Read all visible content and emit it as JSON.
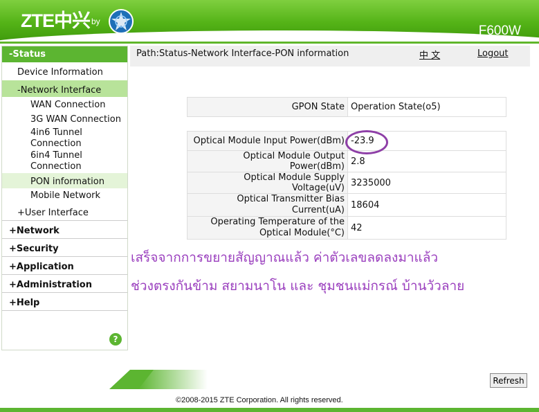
{
  "header": {
    "logo": "ZTE中兴",
    "by": "by",
    "model": "F600W"
  },
  "sidebar": {
    "status": "-Status",
    "device_information": "Device Information",
    "network_interface": "-Network Interface",
    "wan_connection": "WAN Connection",
    "wan_3g": "3G WAN Connection",
    "tunnel_4in6_line1": "4in6 Tunnel",
    "tunnel_4in6_line2": "Connection",
    "tunnel_6in4_line1": "6in4 Tunnel",
    "tunnel_6in4_line2": "Connection",
    "pon_information": "PON information",
    "mobile_network": "Mobile Network",
    "user_interface": "+User Interface",
    "network": "+Network",
    "security": "+Security",
    "application": "+Application",
    "administration": "+Administration",
    "help": "+Help",
    "help_icon": "?"
  },
  "main": {
    "path": "Path:Status-Network Interface-PON information",
    "lang": "中 文",
    "logout": "Logout",
    "gpon": {
      "label": "GPON State",
      "value": "Operation State(o5)"
    },
    "rows": [
      {
        "label": "Optical Module Input Power(dBm)",
        "value": "-23.9"
      },
      {
        "label": "Optical Module Output Power(dBm)",
        "value": "2.8"
      },
      {
        "label": "Optical Module Supply Voltage(uV)",
        "value": "3235000"
      },
      {
        "label_line1": "Optical Transmitter Bias",
        "label_line2": "Current(uA)",
        "value": "18604"
      },
      {
        "label_line1": "Operating Temperature of the",
        "label_line2": "Optical Module(°C)",
        "value": "42"
      }
    ],
    "thai_line1": "เสร็จจากการขยายสัญญาณแล้ว ค่าตัวเลขลดลงมาแล้ว",
    "thai_line2": "ช่วงตรงกันข้าม สยามนาโน และ ชุมชนแม่กรณ์ บ้านวัวลาย"
  },
  "footer": {
    "refresh": "Refresh",
    "copyright": "©2008-2015 ZTE Corporation. All rights reserved."
  },
  "colors": {
    "brand_green": "#5cb531",
    "highlight": "#b8e39a",
    "annotation_purple": "#9a3fbe"
  }
}
